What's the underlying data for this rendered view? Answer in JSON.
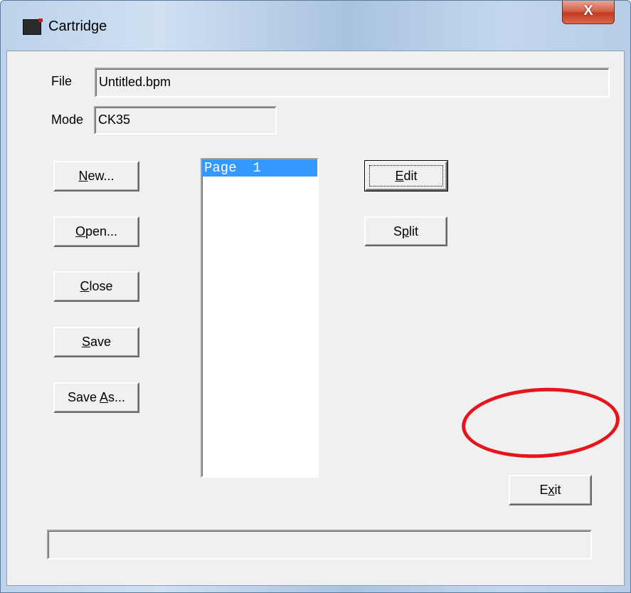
{
  "window": {
    "title": "Cartridge",
    "close_label": "X",
    "icon": "cartridge-app-icon"
  },
  "fields": {
    "file_label": "File",
    "file_value": "Untitled.bpm",
    "mode_label": "Mode",
    "mode_value": "CK35"
  },
  "left_buttons": [
    {
      "pre": "",
      "key": "N",
      "post": "ew..."
    },
    {
      "pre": "",
      "key": "O",
      "post": "pen..."
    },
    {
      "pre": "",
      "key": "C",
      "post": "lose"
    },
    {
      "pre": "",
      "key": "S",
      "post": "ave"
    },
    {
      "pre": "Save ",
      "key": "A",
      "post": "s..."
    }
  ],
  "pages_list": {
    "items": [
      "Page  1"
    ],
    "selected_index": 0
  },
  "right_buttons": {
    "edit": {
      "pre": "",
      "key": "E",
      "post": "dit"
    },
    "split": {
      "pre": "S",
      "key": "p",
      "post": "lit"
    },
    "exit": {
      "pre": "E",
      "key": "x",
      "post": "it"
    }
  },
  "status_text": "",
  "colors": {
    "selection": "#3399ff",
    "annotation": "#e8141c",
    "dialog_background": "#f0f0f0"
  }
}
